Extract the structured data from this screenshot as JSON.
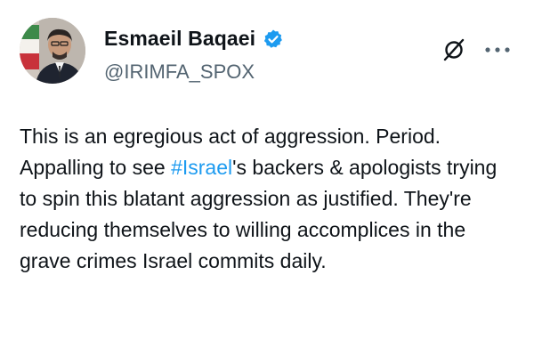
{
  "author": {
    "display_name": "Esmaeil Baqaei",
    "handle": "@IRIMFA_SPOX",
    "verified": true
  },
  "tweet": {
    "text_before": "This is an egregious act of aggression. Period. Appalling to see ",
    "hashtag": "#Israel",
    "text_after": "'s backers & apologists trying to spin this blatant aggression as justified. They're reducing themselves to willing accomplices in the grave crimes Israel commits daily."
  },
  "icons": {
    "verified": "verified-badge-icon",
    "grok": "grok-icon",
    "more": "more-options-icon"
  },
  "colors": {
    "verified": "#1d9bf0",
    "hashtag": "#1d9bf0",
    "handle": "#536471",
    "text": "#0f1419"
  }
}
